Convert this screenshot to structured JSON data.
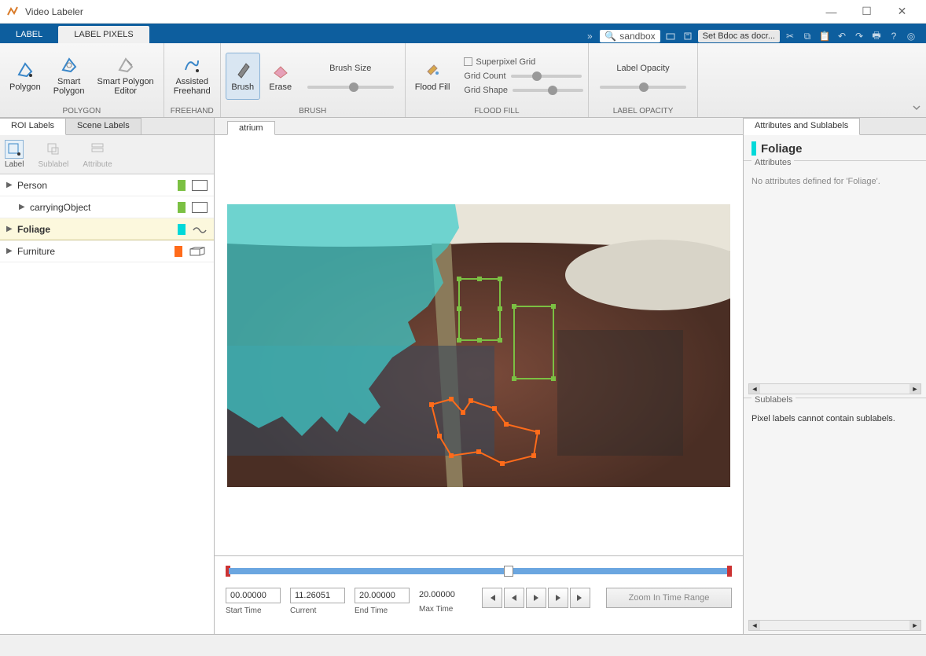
{
  "window": {
    "title": "Video Labeler"
  },
  "tabs": {
    "label": "LABEL",
    "label_pixels": "LABEL PIXELS"
  },
  "quick_access": {
    "search": "sandbox",
    "doc_btn": "Set Bdoc as docr..."
  },
  "ribbon": {
    "polygon": {
      "polygon": "Polygon",
      "smart_polygon": "Smart\nPolygon",
      "smart_polygon_editor": "Smart Polygon\nEditor",
      "group": "POLYGON"
    },
    "freehand": {
      "assisted": "Assisted\nFreehand",
      "group": "FREEHAND"
    },
    "brush": {
      "brush": "Brush",
      "erase": "Erase",
      "size_label": "Brush Size",
      "group": "BRUSH"
    },
    "flood": {
      "flood_fill": "Flood Fill",
      "superpixel": "Superpixel Grid",
      "grid_count": "Grid Count",
      "grid_shape": "Grid Shape",
      "group": "FLOOD FILL"
    },
    "opacity": {
      "label": "Label Opacity",
      "group": "LABEL OPACITY"
    }
  },
  "left": {
    "tabs": {
      "roi": "ROI Labels",
      "scene": "Scene Labels"
    },
    "tools": {
      "label": "Label",
      "sublabel": "Sublabel",
      "attribute": "Attribute"
    },
    "labels": [
      {
        "name": "Person",
        "color": "#7bc043",
        "selected": false,
        "child": false,
        "type": "rect"
      },
      {
        "name": "carryingObject",
        "color": "#7bc043",
        "selected": false,
        "child": true,
        "type": "rect"
      },
      {
        "name": "Foliage",
        "color": "#00d9d9",
        "selected": true,
        "child": false,
        "type": "pixel"
      },
      {
        "name": "Furniture",
        "color": "#ff6b1a",
        "selected": false,
        "child": false,
        "type": "cuboid"
      }
    ]
  },
  "center": {
    "video_tab": "atrium",
    "timeline": {
      "start": "00.00000",
      "start_lbl": "Start Time",
      "current": "11.26051",
      "current_lbl": "Current",
      "end": "20.00000",
      "end_lbl": "End Time",
      "max": "20.00000",
      "max_lbl": "Max Time",
      "zoom": "Zoom In Time Range"
    }
  },
  "right": {
    "tab": "Attributes and Sublabels",
    "title": "Foliage",
    "title_color": "#00d9d9",
    "attrs_lbl": "Attributes",
    "attrs_body": "No attributes defined for 'Foliage'.",
    "sub_lbl": "Sublabels",
    "sub_body": "Pixel labels cannot contain sublabels."
  }
}
